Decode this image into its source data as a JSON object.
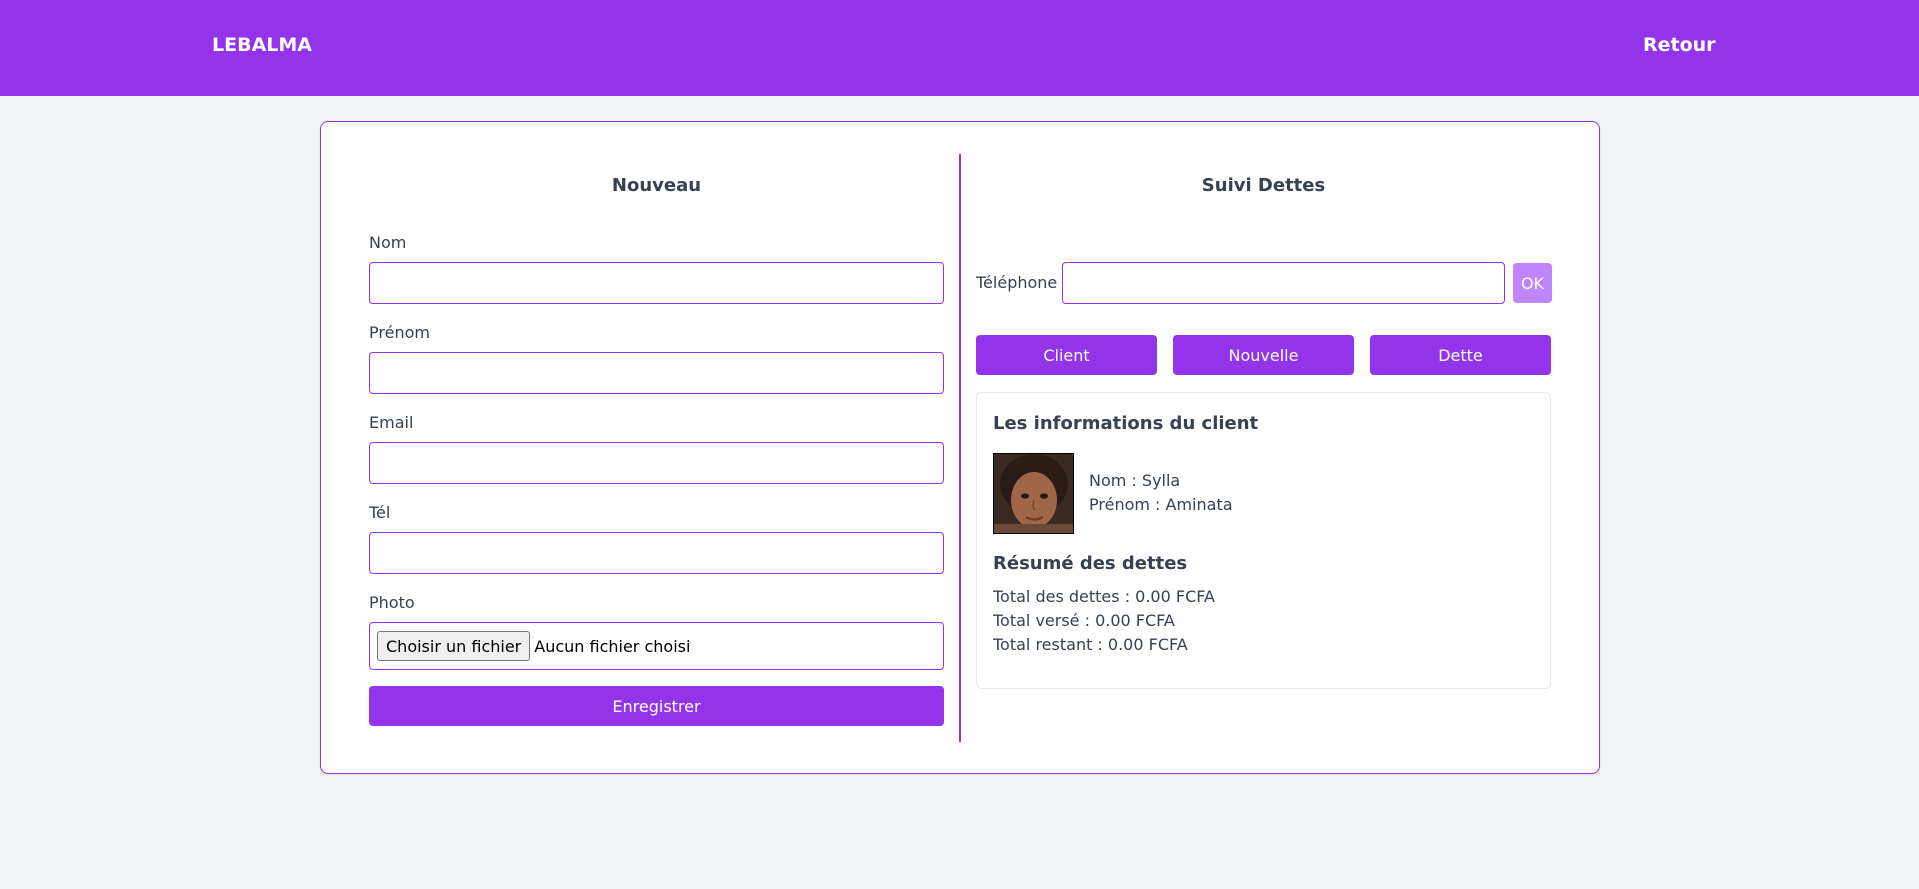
{
  "header": {
    "brand": "LEBALMA",
    "back_label": "Retour"
  },
  "new_form": {
    "title": "Nouveau",
    "fields": [
      {
        "label": "Nom",
        "value": ""
      },
      {
        "label": "Prénom",
        "value": ""
      },
      {
        "label": "Email",
        "value": ""
      },
      {
        "label": "Tél",
        "value": ""
      }
    ],
    "photo_label": "Photo",
    "file_button": "Choisir un fichier",
    "file_status": "Aucun fichier choisi",
    "submit_label": "Enregistrer"
  },
  "debt_tracking": {
    "title": "Suivi Dettes",
    "phone_label": "Téléphone",
    "phone_value": "",
    "ok_label": "OK",
    "tabs": [
      "Client",
      "Nouvelle",
      "Dette"
    ],
    "client_info_title": "Les informations du client",
    "client_name": "Nom : Sylla",
    "client_firstname": "Prénom : Aminata",
    "summary_title": "Résumé des dettes",
    "total_debts": "Total des dettes : 0.00 FCFA",
    "total_paid": "Total versé : 0.00 FCFA",
    "total_remaining": "Total restant : 0.00 FCFA"
  },
  "colors": {
    "primary": "#9333ea",
    "primary_light": "#c084fc",
    "background": "#f3f4f6"
  }
}
